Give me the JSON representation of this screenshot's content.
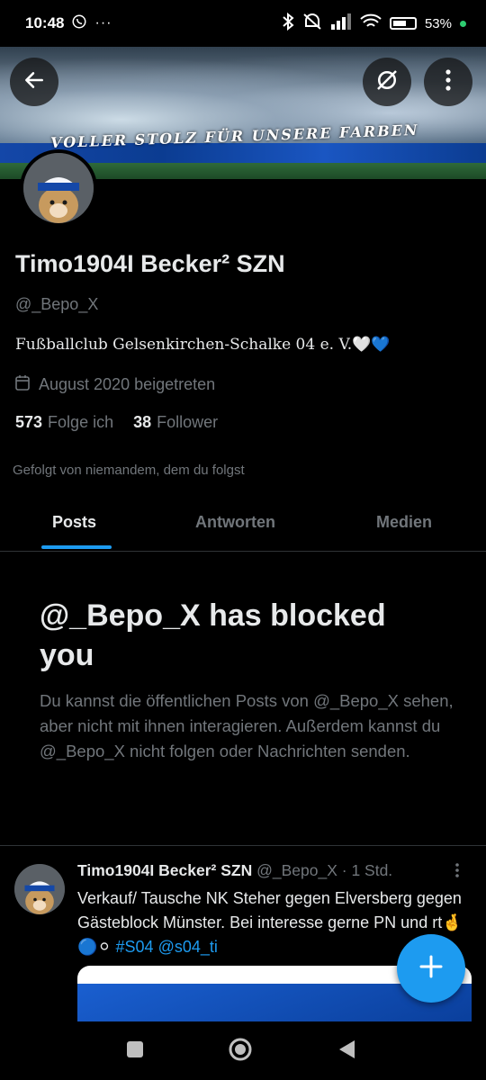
{
  "status_bar": {
    "time": "10:48",
    "battery": "53%"
  },
  "banner": {
    "text": "VOLLER STOLZ FÜR UNSERE FARBEN"
  },
  "profile": {
    "name": "Timo1904I Becker² SZN",
    "handle": "@_Bepo_X",
    "bio": "Fußballclub Gelsenkirchen-Schalke 04 e. V.🤍💙",
    "joined": "August 2020 beigetreten",
    "following_count": "573",
    "following_label": "Folge ich",
    "followers_count": "38",
    "followers_label": "Follower",
    "followed_by": "Gefolgt von niemandem, dem du folgst"
  },
  "tabs": [
    {
      "label": "Posts",
      "active": true
    },
    {
      "label": "Antworten",
      "active": false
    },
    {
      "label": "Medien",
      "active": false
    }
  ],
  "blocked": {
    "title": "@_Bepo_X has blocked you",
    "description": "Du kannst die öffentlichen Posts von @_Bepo_X sehen, aber nicht mit ihnen interagieren. Außerdem kannst du @_Bepo_X nicht folgen oder Nachrichten senden."
  },
  "post": {
    "name": "Timo1904I Becker² SZN",
    "handle": "@_Bepo_X",
    "time": "· 1 Std.",
    "text": "Verkauf/ Tausche NK Steher gegen Elversberg gegen Gästeblock Münster. Bei interesse gerne PN und rt🤞🔵⚪",
    "hashtag": "#S04",
    "mention": "@s04_ti"
  },
  "colors": {
    "accent": "#1d9bf0",
    "muted": "#71767b",
    "text": "#e7e9ea",
    "divider": "#2f3336"
  }
}
